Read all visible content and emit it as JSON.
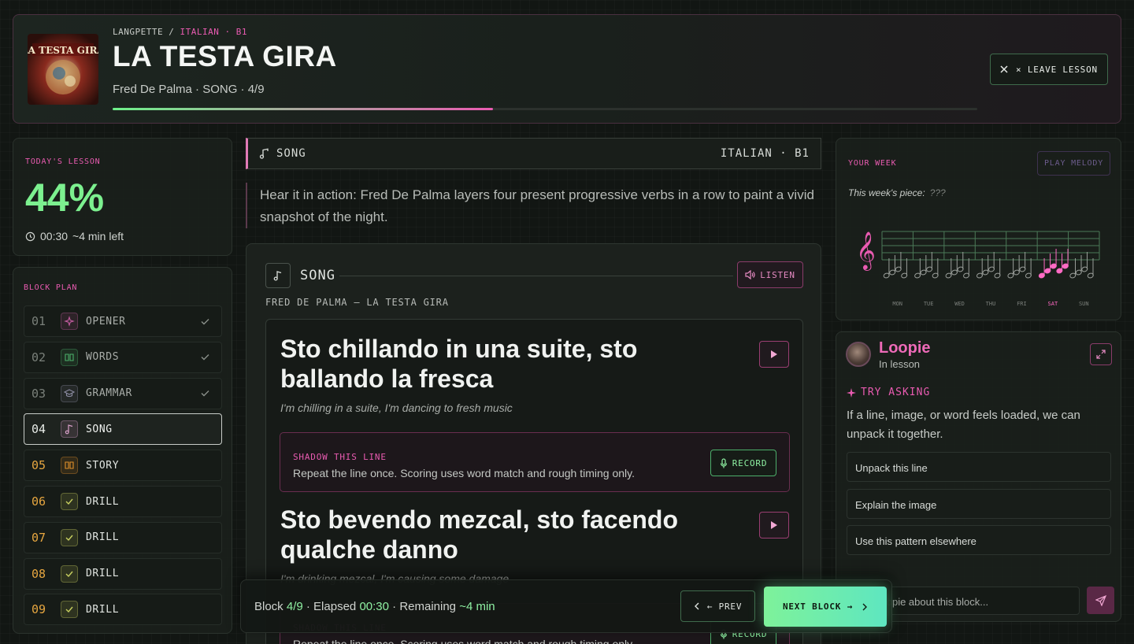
{
  "header": {
    "breadcrumb_app": "LANGPETTE",
    "breadcrumb_sep": "/",
    "breadcrumb_lang": "ITALIAN · B1",
    "title": "LA TESTA GIRA",
    "meta": "Fred De Palma · SONG · 4/9",
    "progress_fraction": 0.44,
    "leave_label": "× LEAVE LESSON",
    "cover_text": "LA TESTA GIRA"
  },
  "today": {
    "label": "TODAY'S LESSON",
    "percent": "44%",
    "elapsed": "00:30",
    "left": "~4 min left"
  },
  "plan": {
    "label": "BLOCK PLAN",
    "items": [
      {
        "num": "01",
        "name": "OPENER",
        "state": "done"
      },
      {
        "num": "02",
        "name": "WORDS",
        "state": "done"
      },
      {
        "num": "03",
        "name": "GRAMMAR",
        "state": "done"
      },
      {
        "num": "04",
        "name": "SONG",
        "state": "active"
      },
      {
        "num": "05",
        "name": "STORY",
        "state": "todo"
      },
      {
        "num": "06",
        "name": "DRILL",
        "state": "todo"
      },
      {
        "num": "07",
        "name": "DRILL",
        "state": "todo"
      },
      {
        "num": "08",
        "name": "DRILL",
        "state": "todo"
      },
      {
        "num": "09",
        "name": "DRILL",
        "state": "todo"
      }
    ]
  },
  "section": {
    "label": "SONG",
    "lang": "ITALIAN · B1",
    "intro": "Hear it in action: Fred De Palma layers four present progressive verbs in a row to paint a vivid snapshot of the night."
  },
  "card": {
    "label": "SONG",
    "listen_label": "LISTEN",
    "artist_line": "FRED DE PALMA — LA TESTA GIRA",
    "lines": [
      {
        "text": "Sto chillando in una suite, sto ballando la fresca",
        "translation": "I'm chilling in a suite, I'm dancing to fresh music"
      },
      {
        "text": "Sto bevendo mezcal, sto facendo qualche danno",
        "translation": "I'm drinking mezcal, I'm causing some damage"
      }
    ],
    "shadow_title": "SHADOW THIS LINE",
    "shadow_desc": "Repeat the line once. Scoring uses word match and rough timing only.",
    "record_label": "RECORD"
  },
  "bottom": {
    "block_prefix": "Block",
    "block_value": "4/9",
    "elapsed_prefix": "· Elapsed",
    "elapsed_value": "00:30",
    "remaining_prefix": "· Remaining",
    "remaining_value": "~4 min",
    "prev_label": "← PREV",
    "next_label": "NEXT BLOCK →"
  },
  "week": {
    "label": "YOUR WEEK",
    "melody_label": "PLAY MELODY",
    "piece_label": "This week's piece:",
    "piece_value": "???",
    "days": [
      "MON",
      "TUE",
      "WED",
      "THU",
      "FRI",
      "SAT",
      "SUN"
    ],
    "active_day": "SAT"
  },
  "loopie": {
    "name": "Loopie",
    "status": "In lesson",
    "try_label": "TRY ASKING",
    "try_desc": "If a line, image, or word feels loaded, we can unpack it together.",
    "suggestions": [
      "Unpack this line",
      "Explain the image",
      "Use this pattern elsewhere"
    ],
    "chat_placeholder": "Ask Loopie about this block..."
  },
  "colors": {
    "accent_green": "#7cf08f",
    "accent_pink": "#e95bb1",
    "background": "#121613"
  }
}
